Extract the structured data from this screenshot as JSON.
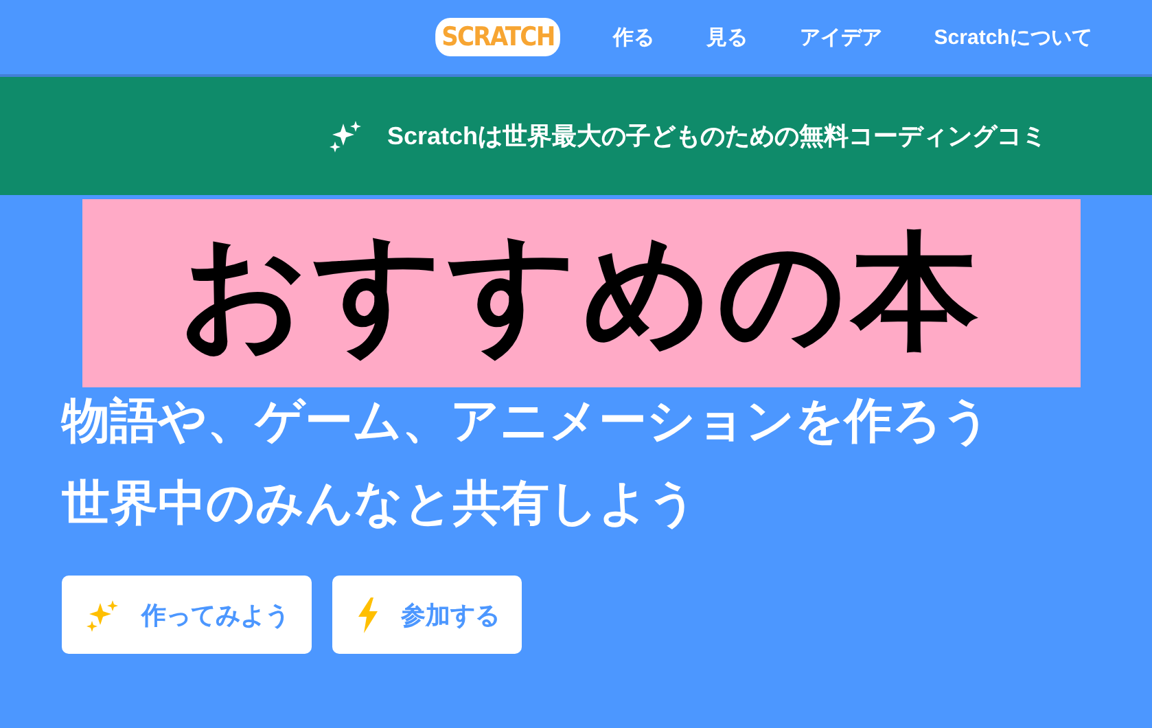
{
  "nav": {
    "logo": "SCRATCH",
    "items": [
      {
        "label": "作る"
      },
      {
        "label": "見る"
      },
      {
        "label": "アイデア"
      },
      {
        "label": "Scratchについて"
      }
    ]
  },
  "banner": {
    "text": "Scratchは世界最大の子どものための無料コーディングコミ"
  },
  "overlay": {
    "text": "おすすめの本"
  },
  "hero": {
    "lines": [
      "物語や、ゲーム、アニメーションを作ろう",
      "世界中のみんなと共有しよう"
    ],
    "buttons": [
      {
        "label": "作ってみよう"
      },
      {
        "label": "参加する"
      }
    ]
  }
}
